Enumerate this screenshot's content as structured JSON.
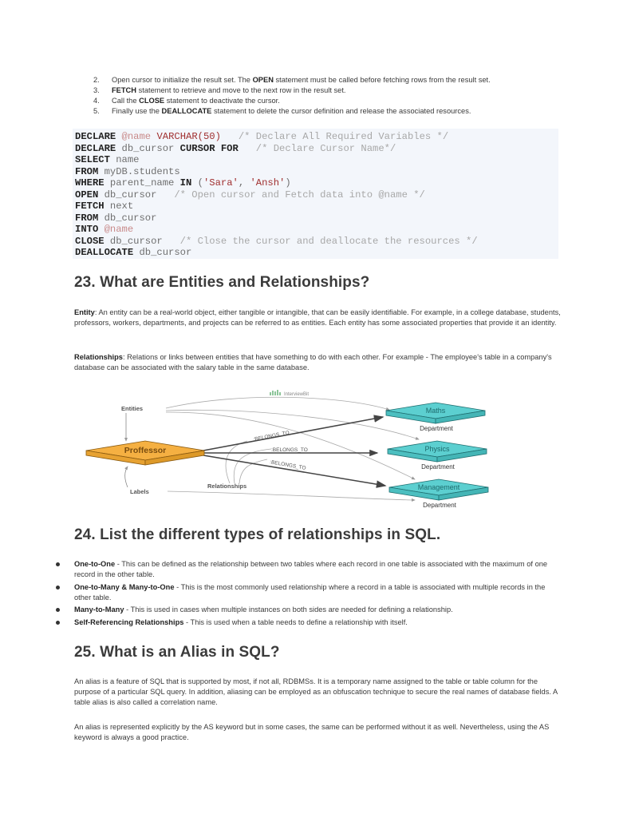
{
  "steps": [
    {
      "num": "2.",
      "before": "Open cursor to initialize the result set. The ",
      "bold": "OPEN",
      "after": " statement must be called before fetching rows from the result set."
    },
    {
      "num": "3.",
      "before": "",
      "bold": "FETCH",
      "after": " statement to retrieve and move to the next row in the result set."
    },
    {
      "num": "4.",
      "before": "Call the ",
      "bold": "CLOSE",
      "after": " statement to deactivate the cursor."
    },
    {
      "num": "5.",
      "before": "Finally use the ",
      "bold": "DEALLOCATE",
      "after": " statement to delete the cursor definition and release the associated resources."
    }
  ],
  "code": {
    "lines": [
      [
        {
          "t": "kw",
          "v": "DECLARE"
        },
        {
          "t": "plain",
          "v": " "
        },
        {
          "t": "var",
          "v": "@name"
        },
        {
          "t": "plain",
          "v": " "
        },
        {
          "t": "typ",
          "v": "VARCHAR(50)"
        },
        {
          "t": "plain",
          "v": "   "
        },
        {
          "t": "cm",
          "v": "/* Declare All Required Variables */"
        }
      ],
      [
        {
          "t": "kw",
          "v": "DECLARE"
        },
        {
          "t": "plain",
          "v": " db_cursor "
        },
        {
          "t": "kw",
          "v": "CURSOR FOR"
        },
        {
          "t": "plain",
          "v": "   "
        },
        {
          "t": "cm",
          "v": "/* Declare Cursor Name*/"
        }
      ],
      [
        {
          "t": "kw",
          "v": "SELECT"
        },
        {
          "t": "plain",
          "v": " name"
        }
      ],
      [
        {
          "t": "kw",
          "v": "FROM"
        },
        {
          "t": "plain",
          "v": " myDB.students"
        }
      ],
      [
        {
          "t": "kw",
          "v": "WHERE"
        },
        {
          "t": "plain",
          "v": " parent_name "
        },
        {
          "t": "kw",
          "v": "IN"
        },
        {
          "t": "plain",
          "v": " ("
        },
        {
          "t": "str",
          "v": "'Sara'"
        },
        {
          "t": "plain",
          "v": ", "
        },
        {
          "t": "str",
          "v": "'Ansh'"
        },
        {
          "t": "plain",
          "v": ")"
        }
      ],
      [
        {
          "t": "kw",
          "v": "OPEN"
        },
        {
          "t": "plain",
          "v": " db_cursor   "
        },
        {
          "t": "cm",
          "v": "/* Open cursor and Fetch data into @name */"
        }
      ],
      [
        {
          "t": "kw",
          "v": "FETCH"
        },
        {
          "t": "plain",
          "v": " next"
        }
      ],
      [
        {
          "t": "kw",
          "v": "FROM"
        },
        {
          "t": "plain",
          "v": " db_cursor"
        }
      ],
      [
        {
          "t": "kw",
          "v": "INTO"
        },
        {
          "t": "plain",
          "v": " "
        },
        {
          "t": "var",
          "v": "@name"
        }
      ],
      [
        {
          "t": "kw",
          "v": "CLOSE"
        },
        {
          "t": "plain",
          "v": " db_cursor   "
        },
        {
          "t": "cm",
          "v": "/* Close the cursor and deallocate the resources */"
        }
      ],
      [
        {
          "t": "kw",
          "v": "DEALLOCATE"
        },
        {
          "t": "plain",
          "v": " db_cursor"
        }
      ]
    ]
  },
  "section23": {
    "heading": "23. What are Entities and Relationships?",
    "entity_label": "Entity",
    "entity_text": ": An entity can be a real-world object, either tangible or intangible, that can be easily identifiable. For example, in a college database, students, professors, workers, departments, and projects can be referred to as entities. Each entity has some associated properties that provide it an identity.",
    "relationships_label": "Relationships",
    "relationships_text": ": Relations or links between entities that have something to do with each other. For example - The employee's table in a company's database can be associated with the salary table in the same database."
  },
  "diagram": {
    "watermark": "InterviewBit",
    "entities_label": "Entities",
    "labels_label": "Labels",
    "relationships_label": "Relationships",
    "source_node": "Proffessor",
    "targets": [
      {
        "name": "Maths",
        "label": "Department"
      },
      {
        "name": "Physics",
        "label": "Department"
      },
      {
        "name": "Management",
        "label": "Department"
      }
    ],
    "edge_label": ":BELONGS_TO",
    "colors": {
      "source": "#f5b042",
      "target": "#5ccfd0",
      "edge": "#444444",
      "annotation": "#999999"
    }
  },
  "section24": {
    "heading": "24. List the different types of relationships in SQL.",
    "items": [
      {
        "term": "One-to-One",
        "text": " - This can be defined as the relationship between two tables where each record in one table is associated with the maximum of one record in the other table."
      },
      {
        "term": "One-to-Many & Many-to-One",
        "text": " - This is the most commonly used relationship where a record in a table is associated with multiple records in the other table."
      },
      {
        "term": "Many-to-Many",
        "text": " - This is used in cases when multiple instances on both sides are needed for defining a relationship."
      },
      {
        "term": "Self-Referencing Relationships",
        "text": " - This is used when a table needs to define a relationship with itself."
      }
    ]
  },
  "section25": {
    "heading": "25. What is an Alias in SQL?",
    "para1": "An alias is a feature of SQL that is supported by most, if not all, RDBMSs. It is a temporary name assigned to the table or table column for the purpose of a particular SQL query. In addition, aliasing can be employed as an obfuscation technique to secure the real names of database fields. A table alias is also called a correlation name.",
    "para2": "An alias is represented explicitly by the AS keyword but in some cases, the same can be performed without it as well. Nevertheless, using the AS keyword is always a good practice."
  }
}
